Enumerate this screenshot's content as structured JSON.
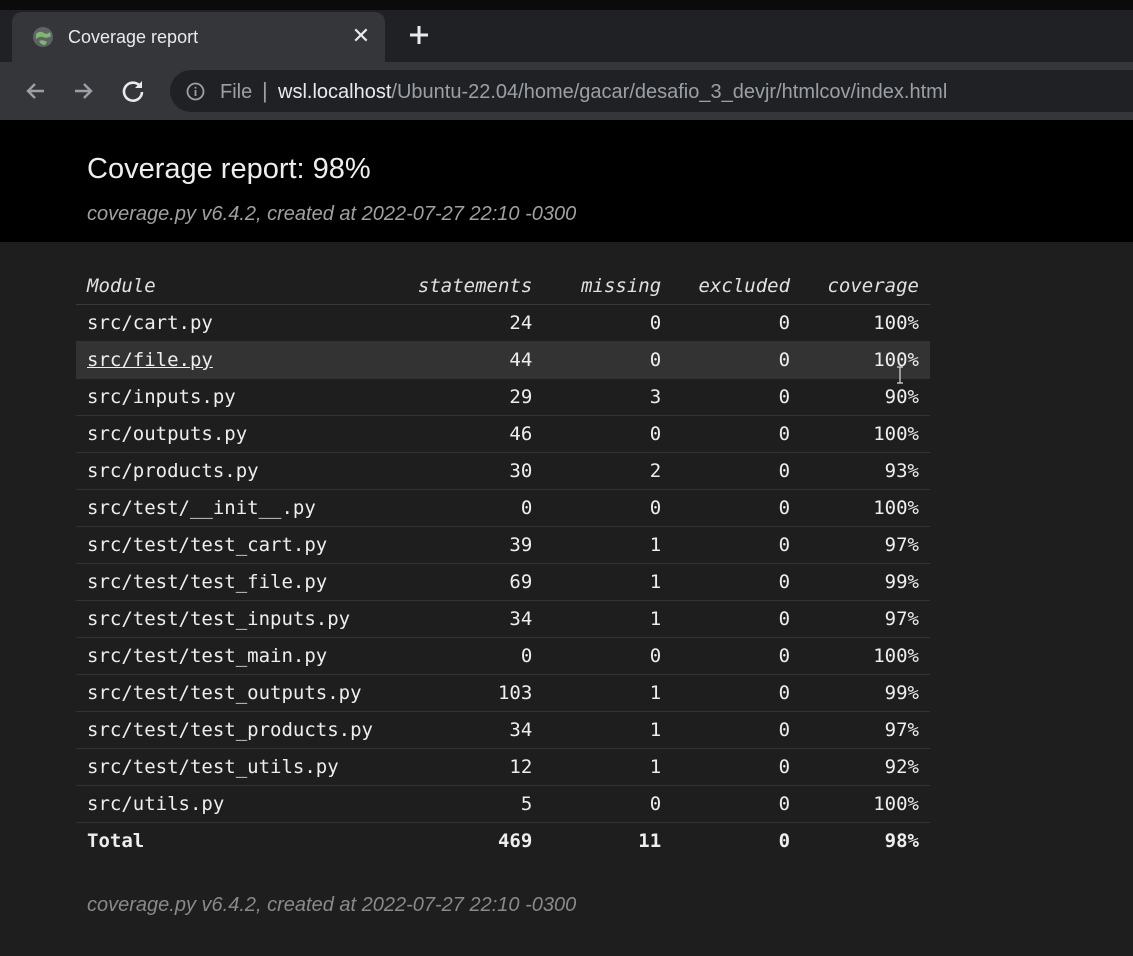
{
  "browser": {
    "tab": {
      "title": "Coverage report",
      "close_glyph": "✕"
    },
    "new_tab_glyph": "+",
    "address": {
      "scheme": "File",
      "separator": "|",
      "host": "wsl.localhost",
      "path": "/Ubuntu-22.04/home/gacar/desafio_3_devjr/htmlcov/index.html"
    },
    "icons": [
      "globe-favicon-icon",
      "back-arrow-icon",
      "forward-arrow-icon",
      "reload-icon",
      "info-icon",
      "plus-icon",
      "close-icon"
    ]
  },
  "report": {
    "title": "Coverage report: 98%",
    "created": "coverage.py v6.4.2, created at 2022-07-27 22:10 -0300",
    "footer": "coverage.py v6.4.2, created at 2022-07-27 22:10 -0300",
    "columns": {
      "module": "Module",
      "statements": "statements",
      "missing": "missing",
      "excluded": "excluded",
      "coverage": "coverage"
    },
    "rows": [
      {
        "module": "src/cart.py",
        "statements": "24",
        "missing": "0",
        "excluded": "0",
        "coverage": "100%"
      },
      {
        "module": "src/file.py",
        "statements": "44",
        "missing": "0",
        "excluded": "0",
        "coverage": "100%"
      },
      {
        "module": "src/inputs.py",
        "statements": "29",
        "missing": "3",
        "excluded": "0",
        "coverage": "90%"
      },
      {
        "module": "src/outputs.py",
        "statements": "46",
        "missing": "0",
        "excluded": "0",
        "coverage": "100%"
      },
      {
        "module": "src/products.py",
        "statements": "30",
        "missing": "2",
        "excluded": "0",
        "coverage": "93%"
      },
      {
        "module": "src/test/__init__.py",
        "statements": "0",
        "missing": "0",
        "excluded": "0",
        "coverage": "100%"
      },
      {
        "module": "src/test/test_cart.py",
        "statements": "39",
        "missing": "1",
        "excluded": "0",
        "coverage": "97%"
      },
      {
        "module": "src/test/test_file.py",
        "statements": "69",
        "missing": "1",
        "excluded": "0",
        "coverage": "99%"
      },
      {
        "module": "src/test/test_inputs.py",
        "statements": "34",
        "missing": "1",
        "excluded": "0",
        "coverage": "97%"
      },
      {
        "module": "src/test/test_main.py",
        "statements": "0",
        "missing": "0",
        "excluded": "0",
        "coverage": "100%"
      },
      {
        "module": "src/test/test_outputs.py",
        "statements": "103",
        "missing": "1",
        "excluded": "0",
        "coverage": "99%"
      },
      {
        "module": "src/test/test_products.py",
        "statements": "34",
        "missing": "1",
        "excluded": "0",
        "coverage": "97%"
      },
      {
        "module": "src/test/test_utils.py",
        "statements": "12",
        "missing": "1",
        "excluded": "0",
        "coverage": "92%"
      },
      {
        "module": "src/utils.py",
        "statements": "5",
        "missing": "0",
        "excluded": "0",
        "coverage": "100%"
      }
    ],
    "total": {
      "module": "Total",
      "statements": "469",
      "missing": "11",
      "excluded": "0",
      "coverage": "98%"
    }
  }
}
